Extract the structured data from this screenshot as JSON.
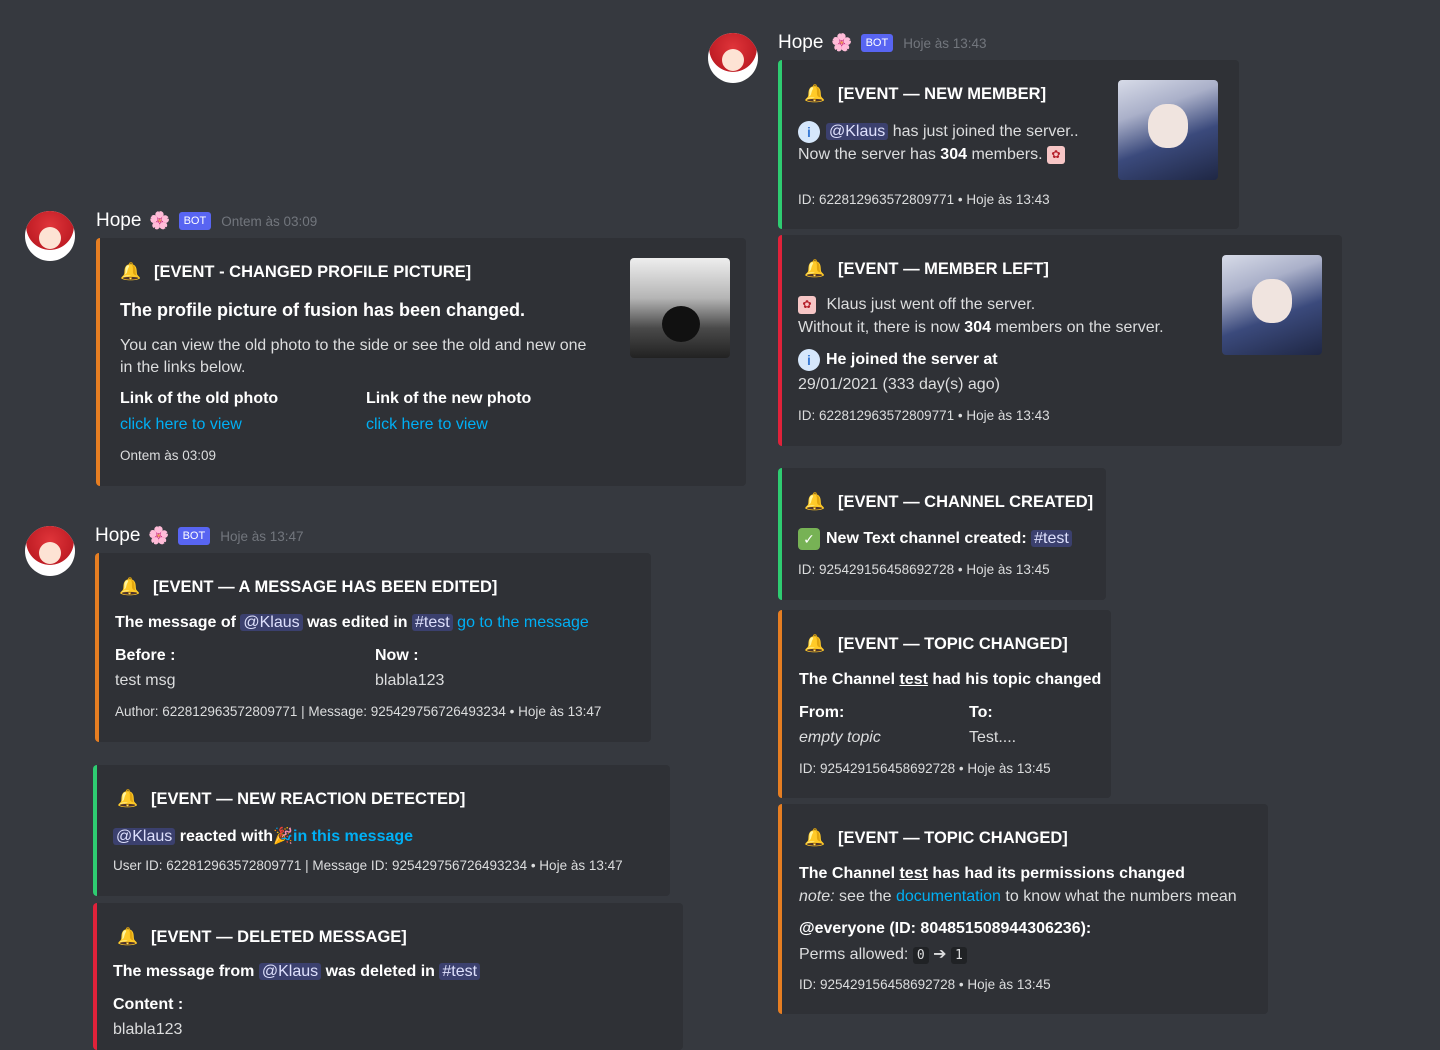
{
  "bot": {
    "name": "Hope",
    "flower": "🌸",
    "badge": "BOT"
  },
  "messages": {
    "m1": {
      "time": "Hoje às 13:43"
    },
    "m2": {
      "time": "Ontem às 03:09"
    },
    "m3": {
      "time": "Hoje às 13:47"
    }
  },
  "bell": "🔔",
  "e_new_member": {
    "title": "[EVENT — NEW MEMBER]",
    "mention": "@Klaus",
    "t1": "has just joined the server..",
    "t2a": "Now the server has",
    "count": "304",
    "t2b": "members.",
    "footer": "ID: 622812963572809771 • Hoje às 13:43"
  },
  "e_profile": {
    "title": "[EVENT - CHANGED PROFILE PICTURE]",
    "headline": "The profile picture of fusion has been changed.",
    "desc1": "You can view the old photo to the side or see the old and new one",
    "desc2": "in the links below.",
    "old_label": "Link of the old photo",
    "old_link": "click here to view",
    "new_label": "Link of the new photo",
    "new_link": "click here to view",
    "footer": "Ontem às 03:09"
  },
  "e_left": {
    "title": "[EVENT — MEMBER LEFT]",
    "l1": "Klaus just went off the server.",
    "l2a": "Without it, there is now",
    "count": "304",
    "l2b": "members on the server.",
    "joined_label": "He joined the server at",
    "joined_value": "29/01/2021 (333 day(s) ago)",
    "footer": "ID: 622812963572809771 • Hoje às 13:43"
  },
  "e_channel": {
    "title": "[EVENT — CHANNEL CREATED]",
    "text": "New Text channel created:",
    "channel": "#test",
    "footer": "ID: 925429156458692728 • Hoje às 13:45"
  },
  "e_edited": {
    "title": "[EVENT — A MESSAGE HAS BEEN EDITED]",
    "p1": "The message of",
    "mention": "@Klaus",
    "p2": "was edited in",
    "channel": "#test",
    "link": "go to the message",
    "before_label": "Before :",
    "before_value": "test msg",
    "now_label": "Now :",
    "now_value": "blabla123",
    "footer": "Author: 622812963572809771 | Message: 925429756726493234 • Hoje às 13:47"
  },
  "e_topic1": {
    "title": "[EVENT — TOPIC CHANGED]",
    "p1": "The Channel",
    "channel": "test",
    "p2": "had his topic changed",
    "from_label": "From:",
    "from_value": "empty topic",
    "to_label": "To:",
    "to_value": "Test....",
    "footer": "ID: 925429156458692728 • Hoje às 13:45"
  },
  "e_reaction": {
    "title": "[EVENT — NEW REACTION DETECTED]",
    "mention": "@Klaus",
    "p1": "reacted with",
    "emoji": "🎉",
    "link": "in this message",
    "footer": "User ID: 622812963572809771 | Message ID: 925429756726493234 • Hoje às 13:47"
  },
  "e_topic2": {
    "title": "[EVENT — TOPIC CHANGED]",
    "p1": "The Channel",
    "channel": "test",
    "p2": "has had its permissions changed",
    "note": "note:",
    "n1": "see the",
    "doc": "documentation",
    "n2": "to know what the numbers mean",
    "everyone": "@everyone (ID: 804851508944306236):",
    "perms_label": "Perms allowed:",
    "from": "0",
    "arrow": "➔",
    "to": "1",
    "footer": "ID: 925429156458692728 • Hoje às 13:45"
  },
  "e_deleted": {
    "title": "[EVENT — DELETED MESSAGE]",
    "p1": "The message from",
    "mention": "@Klaus",
    "p2": "was deleted in",
    "channel": "#test",
    "content_label": "Content :",
    "content_value": "blabla123"
  }
}
